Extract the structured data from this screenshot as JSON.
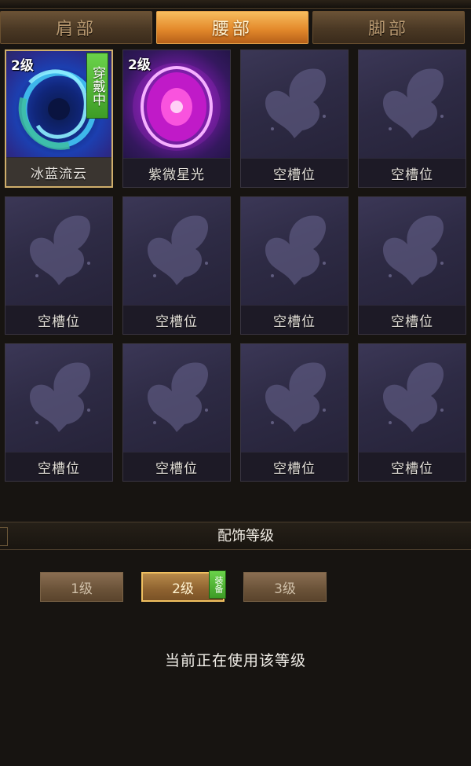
{
  "tabs": [
    {
      "label": "肩部",
      "active": false
    },
    {
      "label": "腰部",
      "active": true
    },
    {
      "label": "脚部",
      "active": false
    }
  ],
  "slots": [
    {
      "name": "冰蓝流云",
      "level": "2级",
      "equipped_tag": "穿戴中",
      "icon": "blue-cloud-swirl-icon",
      "selected": true
    },
    {
      "name": "紫微星光",
      "level": "2级",
      "icon": "purple-starlight-orb-icon"
    },
    {
      "name": "空槽位",
      "icon": "butterfly-placeholder-icon"
    },
    {
      "name": "空槽位",
      "icon": "butterfly-placeholder-icon"
    },
    {
      "name": "空槽位",
      "icon": "butterfly-placeholder-icon"
    },
    {
      "name": "空槽位",
      "icon": "butterfly-placeholder-icon"
    },
    {
      "name": "空槽位",
      "icon": "butterfly-placeholder-icon"
    },
    {
      "name": "空槽位",
      "icon": "butterfly-placeholder-icon"
    },
    {
      "name": "空槽位",
      "icon": "butterfly-placeholder-icon"
    },
    {
      "name": "空槽位",
      "icon": "butterfly-placeholder-icon"
    },
    {
      "name": "空槽位",
      "icon": "butterfly-placeholder-icon"
    },
    {
      "name": "空槽位",
      "icon": "butterfly-placeholder-icon"
    }
  ],
  "level_section": {
    "title": "配饰等级",
    "buttons": [
      {
        "label": "1级",
        "active": false
      },
      {
        "label": "2级",
        "active": true,
        "tag": "装备"
      },
      {
        "label": "3级",
        "active": false
      }
    ],
    "status": "当前正在使用该等级"
  },
  "colors": {
    "tab_active": "#e48a2c",
    "equip_tag": "#3e9c26",
    "selected_border": "#cfae6b",
    "slot_bg": "#2e2b45"
  }
}
